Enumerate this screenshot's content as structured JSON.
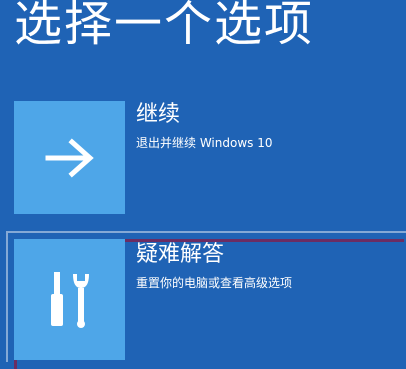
{
  "page": {
    "title": "选择一个选项"
  },
  "options": [
    {
      "label": "继续",
      "description": "退出并继续 Windows 10",
      "icon": "arrow-right-icon"
    },
    {
      "label": "疑难解答",
      "description": "重置你的电脑或查看高级选项",
      "icon": "tools-icon"
    }
  ],
  "colors": {
    "background": "#1f63b5",
    "tile": "#4ea6e8",
    "focus_outline": "#6b2d63",
    "text": "#ffffff"
  }
}
